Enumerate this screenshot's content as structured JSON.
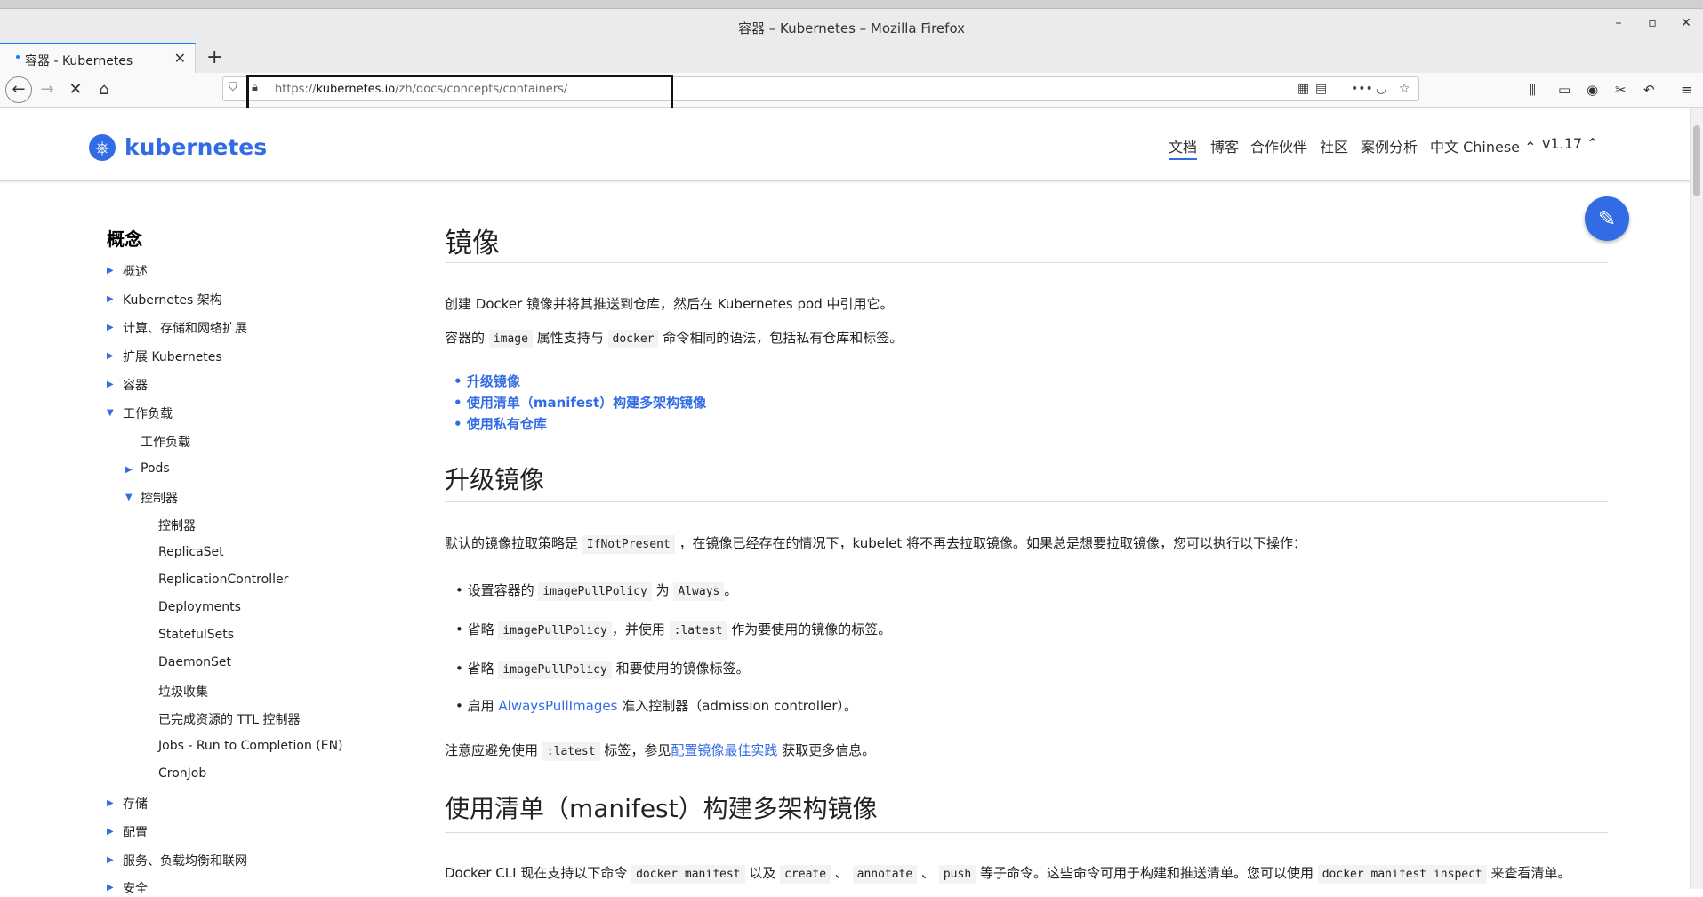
{
  "window": {
    "title": "容器 – Kubernetes – Mozilla Firefox",
    "controls": [
      "–",
      "▫",
      "✕"
    ]
  },
  "tab": {
    "label": "容器 - Kubernetes",
    "close": "✕",
    "new_tab": "+"
  },
  "urlbar": {
    "prefix": "https://",
    "domain": "kubernetes.io",
    "path": "/zh/docs/concepts/containers/"
  },
  "header": {
    "logo_text": "kubernetes",
    "nav": [
      "文档",
      "博客",
      "合作伙伴",
      "社区",
      "案例分析",
      "中文 Chinese ⌃",
      "v1.17 ⌃"
    ]
  },
  "sidebar": {
    "title": "概念",
    "items": [
      {
        "label": "概述",
        "arrow": "▶"
      },
      {
        "label": "Kubernetes 架构",
        "arrow": "▶"
      },
      {
        "label": "计算、存储和网络扩展",
        "arrow": "▶"
      },
      {
        "label": "扩展 Kubernetes",
        "arrow": "▶"
      },
      {
        "label": "容器",
        "arrow": "▶"
      },
      {
        "label": "工作负载",
        "arrow": "▼"
      },
      {
        "label": "工作负载",
        "arrow": ""
      },
      {
        "label": "Pods",
        "arrow": "▶"
      },
      {
        "label": "控制器",
        "arrow": "▼"
      },
      {
        "label": "控制器",
        "arrow": ""
      },
      {
        "label": "ReplicaSet",
        "arrow": ""
      },
      {
        "label": "ReplicationController",
        "arrow": ""
      },
      {
        "label": "Deployments",
        "arrow": ""
      },
      {
        "label": "StatefulSets",
        "arrow": ""
      },
      {
        "label": "DaemonSet",
        "arrow": ""
      },
      {
        "label": "垃圾收集",
        "arrow": ""
      },
      {
        "label": "已完成资源的 TTL 控制器",
        "arrow": ""
      },
      {
        "label": "Jobs - Run to Completion (EN)",
        "arrow": ""
      },
      {
        "label": "CronJob",
        "arrow": ""
      },
      {
        "label": "存储",
        "arrow": "▶"
      },
      {
        "label": "配置",
        "arrow": "▶"
      },
      {
        "label": "服务、负载均衡和联网",
        "arrow": "▶"
      },
      {
        "label": "安全",
        "arrow": "▶"
      }
    ]
  },
  "main": {
    "title": "镜像",
    "intro": "创建 Docker 镜像并将其推送到仓库，然后在 Kubernetes pod 中引用它。",
    "p2_a": "容器的",
    "p2_code1": "image",
    "p2_b": "属性支持与",
    "p2_code2": "docker",
    "p2_c": "命令相同的语法，包括私有仓库和标签。",
    "toc": [
      "升级镜像",
      "使用清单（manifest）构建多架构镜像",
      "使用私有仓库"
    ],
    "section1_title": "升级镜像",
    "s1_p_a": "默认的镜像拉取策略是",
    "s1_p_code": "IfNotPresent",
    "s1_p_b": "，在镜像已经存在的情况下，kubelet 将不再去拉取镜像。如果总是想要拉取镜像，您可以执行以下操作：",
    "b1_a": "设置容器的",
    "b1_code1": "imagePullPolicy",
    "b1_b": "为",
    "b1_code2": "Always",
    "b1_c": "。",
    "b2_a": "省略",
    "b2_code1": "imagePullPolicy",
    "b2_b": "，并使用",
    "b2_code2": ":latest",
    "b2_c": "作为要使用的镜像的标签。",
    "b3_a": "省略",
    "b3_code1": "imagePullPolicy",
    "b3_b": "和要使用的镜像标签。",
    "b4_a": "启用",
    "b4_link": "AlwaysPullImages",
    "b4_b": "准入控制器（admission controller）。",
    "note_a": "注意应避免使用",
    "note_code": ":latest",
    "note_b": "标签，参见",
    "note_link": "配置镜像最佳实践",
    "note_c": "获取更多信息。",
    "section2_title": "使用清单（manifest）构建多架构镜像",
    "s2_a": "Docker CLI 现在支持以下命令",
    "s2_code1": "docker manifest",
    "s2_b": "以及",
    "s2_code2": "create",
    "s2_c": "、",
    "s2_code3": "annotate",
    "s2_d": "、",
    "s2_code4": "push",
    "s2_e": "等子命令。这些命令可用于构建和推送清单。您可以使用",
    "s2_code5": "docker manifest inspect",
    "s2_f": "来查看清单。"
  },
  "colors": {
    "accent": "#326ce5",
    "tab_accent": "#0a84ff"
  },
  "icons": [
    "back-icon",
    "forward-icon",
    "stop-icon",
    "home-icon",
    "shield-icon",
    "lock-icon",
    "qr-icon",
    "reader-icon",
    "more-icon",
    "pocket-icon",
    "star-icon",
    "library-icon",
    "sidebar-icon",
    "account-icon",
    "screenshot-icon",
    "undo-icon",
    "menu-icon",
    "kubernetes-logo-icon",
    "edit-pencil-icon"
  ]
}
